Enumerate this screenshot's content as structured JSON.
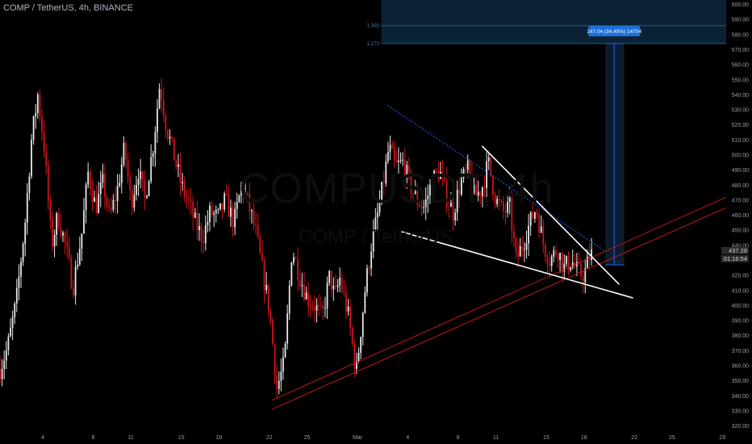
{
  "header": {
    "symbol_line": "COMP / TetherUS, 4h, BINANCE"
  },
  "watermark": {
    "main": "COMPUSDT, 4h",
    "sub": "COMP / TetherUS"
  },
  "price_axis": {
    "ticks": [
      600,
      590,
      580,
      570,
      560,
      550,
      540,
      530,
      520,
      510,
      500,
      490,
      480,
      470,
      460,
      450,
      440,
      430,
      420,
      410,
      400,
      390,
      380,
      370,
      360,
      350,
      340,
      330,
      320
    ],
    "current_price": "437.28",
    "countdown": "01:16:54",
    "ylim": [
      316,
      603
    ]
  },
  "time_axis": {
    "labels": [
      {
        "label": "4",
        "t": 4
      },
      {
        "label": "8",
        "t": 8
      },
      {
        "label": "11",
        "t": 11
      },
      {
        "label": "15",
        "t": 15
      },
      {
        "label": "18",
        "t": 18
      },
      {
        "label": "22",
        "t": 22
      },
      {
        "label": "25",
        "t": 25
      },
      {
        "label": "Mar",
        "t": 29
      },
      {
        "label": "4",
        "t": 33
      },
      {
        "label": "8",
        "t": 37
      },
      {
        "label": "11",
        "t": 40
      },
      {
        "label": "15",
        "t": 44
      },
      {
        "label": "18",
        "t": 47
      },
      {
        "label": "22",
        "t": 51
      },
      {
        "label": "25",
        "t": 54
      },
      {
        "label": "29",
        "t": 58
      }
    ],
    "xlim": [
      0.6,
      58.3
    ]
  },
  "projection": {
    "label": "147.04 (34.45%) 14704",
    "from_price": 427,
    "to_price": 574,
    "fib_levels": [
      {
        "label": "1.382",
        "price": 586
      },
      {
        "label": "1.272",
        "price": 574
      }
    ],
    "colors": {
      "zone": "#0b2236",
      "line": "#2962ff",
      "label_bg": "#1e6fd9",
      "label_text": "#ffffff"
    }
  },
  "drawings": {
    "wedge_upper": [
      {
        "t": 38.9,
        "p": 506
      },
      {
        "t": 49.8,
        "p": 414
      }
    ],
    "wedge_lower": [
      {
        "t": 32.5,
        "p": 449
      },
      {
        "t": 50.9,
        "p": 405
      }
    ],
    "support_channel": [
      {
        "from": {
          "t": 22.2,
          "p": 331
        },
        "to": {
          "t": 58.3,
          "p": 465
        }
      },
      {
        "from": {
          "t": 22.2,
          "p": 337
        },
        "to": {
          "t": 58.3,
          "p": 472
        }
      }
    ],
    "dotted_decline": [
      {
        "t": 31.4,
        "p": 533
      },
      {
        "t": 48.7,
        "p": 436
      }
    ],
    "colors": {
      "wedge": "#ffffff",
      "channel": "#c0161a",
      "dotted": "#2962ff"
    }
  },
  "chart_data": {
    "type": "candlestick",
    "title": "COMP / TetherUS, 4h, BINANCE",
    "xlabel": "",
    "ylabel": "",
    "ylim": [
      316,
      603
    ],
    "colors": {
      "up": "#e8e8e8",
      "down": "#d0141a",
      "background": "#000000"
    },
    "price_path": [
      [
        0.6,
        358
      ],
      [
        1.2,
        372
      ],
      [
        1.9,
        403
      ],
      [
        2.6,
        456
      ],
      [
        3.1,
        510
      ],
      [
        3.6,
        540
      ],
      [
        4.1,
        506
      ],
      [
        4.7,
        440
      ],
      [
        5.2,
        460
      ],
      [
        5.8,
        440
      ],
      [
        6.4,
        412
      ],
      [
        7.1,
        448
      ],
      [
        7.6,
        488
      ],
      [
        8.2,
        465
      ],
      [
        8.8,
        482
      ],
      [
        9.3,
        458
      ],
      [
        9.9,
        476
      ],
      [
        10.5,
        505
      ],
      [
        11.0,
        468
      ],
      [
        11.6,
        490
      ],
      [
        12.1,
        470
      ],
      [
        12.8,
        508
      ],
      [
        13.3,
        548
      ],
      [
        13.8,
        520
      ],
      [
        14.4,
        500
      ],
      [
        15.0,
        480
      ],
      [
        15.6,
        468
      ],
      [
        16.1,
        455
      ],
      [
        16.7,
        445
      ],
      [
        17.3,
        462
      ],
      [
        17.9,
        458
      ],
      [
        18.5,
        470
      ],
      [
        19.2,
        455
      ],
      [
        19.8,
        480
      ],
      [
        20.3,
        468
      ],
      [
        20.9,
        450
      ],
      [
        21.4,
        425
      ],
      [
        22.0,
        398
      ],
      [
        22.6,
        345
      ],
      [
        23.2,
        362
      ],
      [
        23.8,
        438
      ],
      [
        24.4,
        420
      ],
      [
        25.0,
        405
      ],
      [
        25.6,
        400
      ],
      [
        26.2,
        392
      ],
      [
        26.8,
        420
      ],
      [
        27.2,
        405
      ],
      [
        27.6,
        418
      ],
      [
        28.3,
        392
      ],
      [
        28.9,
        355
      ],
      [
        29.6,
        410
      ],
      [
        30.1,
        440
      ],
      [
        30.8,
        468
      ],
      [
        31.5,
        505
      ],
      [
        32.0,
        492
      ],
      [
        32.6,
        495
      ],
      [
        33.2,
        480
      ],
      [
        33.7,
        470
      ],
      [
        34.3,
        465
      ],
      [
        34.9,
        482
      ],
      [
        35.5,
        490
      ],
      [
        36.1,
        472
      ],
      [
        36.6,
        462
      ],
      [
        37.2,
        482
      ],
      [
        37.8,
        490
      ],
      [
        38.3,
        472
      ],
      [
        38.9,
        478
      ],
      [
        39.4,
        495
      ],
      [
        40.0,
        470
      ],
      [
        40.6,
        462
      ],
      [
        41.1,
        465
      ],
      [
        41.6,
        430
      ],
      [
        42.2,
        442
      ],
      [
        42.7,
        455
      ],
      [
        43.2,
        465
      ],
      [
        43.8,
        440
      ],
      [
        44.3,
        430
      ],
      [
        44.9,
        438
      ],
      [
        45.4,
        425
      ],
      [
        46.0,
        430
      ],
      [
        46.5,
        422
      ],
      [
        47.0,
        420
      ],
      [
        47.6,
        437
      ]
    ],
    "last_price": 437.28
  }
}
